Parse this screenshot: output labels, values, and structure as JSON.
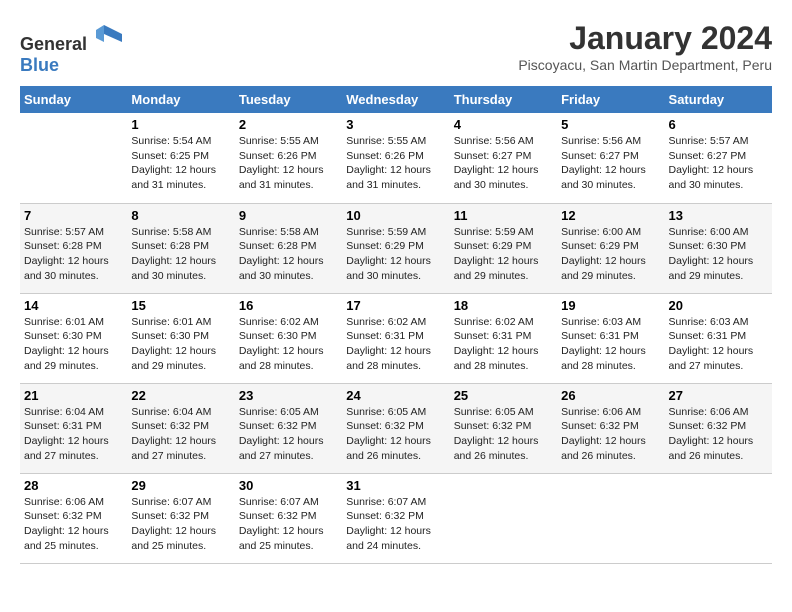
{
  "header": {
    "logo": {
      "text_general": "General",
      "text_blue": "Blue"
    },
    "title": "January 2024",
    "location": "Piscoyacu, San Martin Department, Peru"
  },
  "weekdays": [
    "Sunday",
    "Monday",
    "Tuesday",
    "Wednesday",
    "Thursday",
    "Friday",
    "Saturday"
  ],
  "weeks": [
    [
      {
        "day": "",
        "content": ""
      },
      {
        "day": "1",
        "content": "Sunrise: 5:54 AM\nSunset: 6:25 PM\nDaylight: 12 hours\nand 31 minutes."
      },
      {
        "day": "2",
        "content": "Sunrise: 5:55 AM\nSunset: 6:26 PM\nDaylight: 12 hours\nand 31 minutes."
      },
      {
        "day": "3",
        "content": "Sunrise: 5:55 AM\nSunset: 6:26 PM\nDaylight: 12 hours\nand 31 minutes."
      },
      {
        "day": "4",
        "content": "Sunrise: 5:56 AM\nSunset: 6:27 PM\nDaylight: 12 hours\nand 30 minutes."
      },
      {
        "day": "5",
        "content": "Sunrise: 5:56 AM\nSunset: 6:27 PM\nDaylight: 12 hours\nand 30 minutes."
      },
      {
        "day": "6",
        "content": "Sunrise: 5:57 AM\nSunset: 6:27 PM\nDaylight: 12 hours\nand 30 minutes."
      }
    ],
    [
      {
        "day": "7",
        "content": "Sunrise: 5:57 AM\nSunset: 6:28 PM\nDaylight: 12 hours\nand 30 minutes."
      },
      {
        "day": "8",
        "content": "Sunrise: 5:58 AM\nSunset: 6:28 PM\nDaylight: 12 hours\nand 30 minutes."
      },
      {
        "day": "9",
        "content": "Sunrise: 5:58 AM\nSunset: 6:28 PM\nDaylight: 12 hours\nand 30 minutes."
      },
      {
        "day": "10",
        "content": "Sunrise: 5:59 AM\nSunset: 6:29 PM\nDaylight: 12 hours\nand 30 minutes."
      },
      {
        "day": "11",
        "content": "Sunrise: 5:59 AM\nSunset: 6:29 PM\nDaylight: 12 hours\nand 29 minutes."
      },
      {
        "day": "12",
        "content": "Sunrise: 6:00 AM\nSunset: 6:29 PM\nDaylight: 12 hours\nand 29 minutes."
      },
      {
        "day": "13",
        "content": "Sunrise: 6:00 AM\nSunset: 6:30 PM\nDaylight: 12 hours\nand 29 minutes."
      }
    ],
    [
      {
        "day": "14",
        "content": "Sunrise: 6:01 AM\nSunset: 6:30 PM\nDaylight: 12 hours\nand 29 minutes."
      },
      {
        "day": "15",
        "content": "Sunrise: 6:01 AM\nSunset: 6:30 PM\nDaylight: 12 hours\nand 29 minutes."
      },
      {
        "day": "16",
        "content": "Sunrise: 6:02 AM\nSunset: 6:30 PM\nDaylight: 12 hours\nand 28 minutes."
      },
      {
        "day": "17",
        "content": "Sunrise: 6:02 AM\nSunset: 6:31 PM\nDaylight: 12 hours\nand 28 minutes."
      },
      {
        "day": "18",
        "content": "Sunrise: 6:02 AM\nSunset: 6:31 PM\nDaylight: 12 hours\nand 28 minutes."
      },
      {
        "day": "19",
        "content": "Sunrise: 6:03 AM\nSunset: 6:31 PM\nDaylight: 12 hours\nand 28 minutes."
      },
      {
        "day": "20",
        "content": "Sunrise: 6:03 AM\nSunset: 6:31 PM\nDaylight: 12 hours\nand 27 minutes."
      }
    ],
    [
      {
        "day": "21",
        "content": "Sunrise: 6:04 AM\nSunset: 6:31 PM\nDaylight: 12 hours\nand 27 minutes."
      },
      {
        "day": "22",
        "content": "Sunrise: 6:04 AM\nSunset: 6:32 PM\nDaylight: 12 hours\nand 27 minutes."
      },
      {
        "day": "23",
        "content": "Sunrise: 6:05 AM\nSunset: 6:32 PM\nDaylight: 12 hours\nand 27 minutes."
      },
      {
        "day": "24",
        "content": "Sunrise: 6:05 AM\nSunset: 6:32 PM\nDaylight: 12 hours\nand 26 minutes."
      },
      {
        "day": "25",
        "content": "Sunrise: 6:05 AM\nSunset: 6:32 PM\nDaylight: 12 hours\nand 26 minutes."
      },
      {
        "day": "26",
        "content": "Sunrise: 6:06 AM\nSunset: 6:32 PM\nDaylight: 12 hours\nand 26 minutes."
      },
      {
        "day": "27",
        "content": "Sunrise: 6:06 AM\nSunset: 6:32 PM\nDaylight: 12 hours\nand 26 minutes."
      }
    ],
    [
      {
        "day": "28",
        "content": "Sunrise: 6:06 AM\nSunset: 6:32 PM\nDaylight: 12 hours\nand 25 minutes."
      },
      {
        "day": "29",
        "content": "Sunrise: 6:07 AM\nSunset: 6:32 PM\nDaylight: 12 hours\nand 25 minutes."
      },
      {
        "day": "30",
        "content": "Sunrise: 6:07 AM\nSunset: 6:32 PM\nDaylight: 12 hours\nand 25 minutes."
      },
      {
        "day": "31",
        "content": "Sunrise: 6:07 AM\nSunset: 6:32 PM\nDaylight: 12 hours\nand 24 minutes."
      },
      {
        "day": "",
        "content": ""
      },
      {
        "day": "",
        "content": ""
      },
      {
        "day": "",
        "content": ""
      }
    ]
  ]
}
